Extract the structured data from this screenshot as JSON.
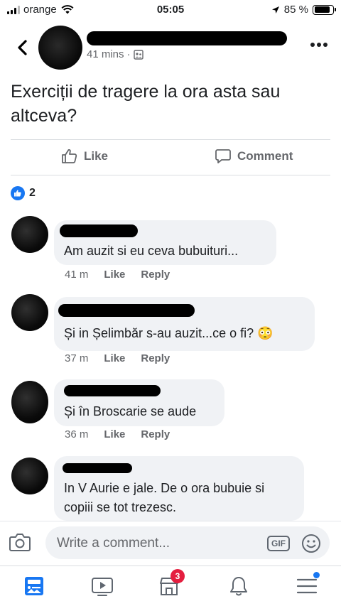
{
  "status_bar": {
    "carrier": "orange",
    "time": "05:05",
    "battery": "85 %",
    "battery_level": 0.85
  },
  "post": {
    "time": "41 mins",
    "separator": "·",
    "text": "Exerciții de tragere la ora asta sau altceva?",
    "like_label": "Like",
    "comment_label": "Comment",
    "reaction_count": "2"
  },
  "comments": [
    {
      "text": "Am auzit si eu ceva bubuituri...",
      "time": "41 m",
      "like": "Like",
      "reply": "Reply"
    },
    {
      "text": "Și in Șelimbăr s-au auzit...ce o fi? 😳",
      "time": "37 m",
      "like": "Like",
      "reply": "Reply"
    },
    {
      "text": "Și în Broscarie se aude",
      "time": "36 m",
      "like": "Like",
      "reply": "Reply"
    },
    {
      "text_lines": [
        "In V Aurie e jale. De o ora bubuie si",
        "copiii se tot trezesc."
      ]
    }
  ],
  "composer": {
    "placeholder": "Write a comment...",
    "gif_label": "GIF"
  },
  "tab_bar": {
    "notifications_badge": "3"
  },
  "colors": {
    "accent": "#1877f2",
    "badge": "#e41e3f",
    "bubble": "#f0f2f5",
    "muted_text": "#65676b"
  }
}
